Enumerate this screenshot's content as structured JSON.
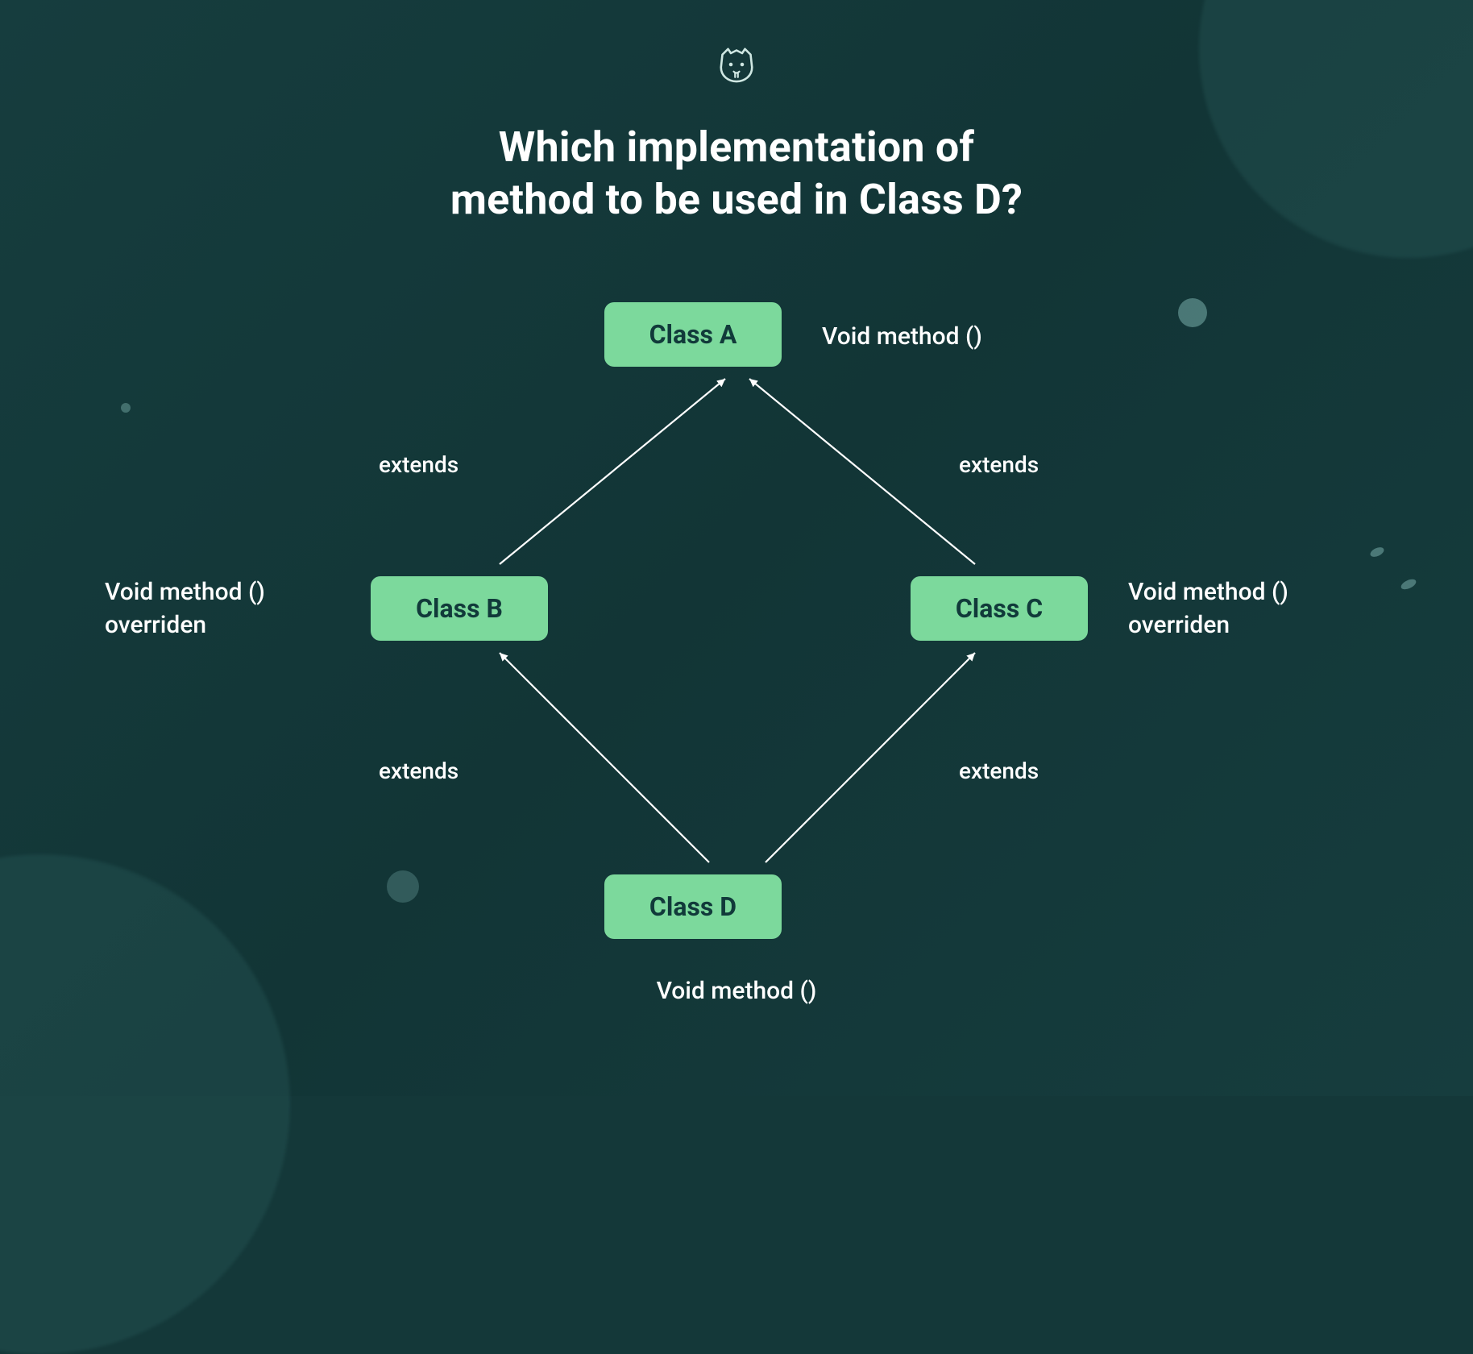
{
  "title_line1": "Which implementation of",
  "title_line2": "method to be used in Class D?",
  "nodes": {
    "a": {
      "label": "Class A",
      "annotation": "Void method ()"
    },
    "b": {
      "label": "Class B",
      "annotation_line1": "Void method ()",
      "annotation_line2": "overriden"
    },
    "c": {
      "label": "Class C",
      "annotation_line1": "Void method ()",
      "annotation_line2": "overriden"
    },
    "d": {
      "label": "Class D",
      "annotation": "Void method ()"
    }
  },
  "edges": {
    "b_to_a": "extends",
    "c_to_a": "extends",
    "d_to_b": "extends",
    "d_to_c": "extends"
  },
  "colors": {
    "background": "#143839",
    "node_fill": "#7cd99c",
    "node_text": "#113a3a",
    "text": "#ffffff",
    "arrow": "#ffffff"
  }
}
